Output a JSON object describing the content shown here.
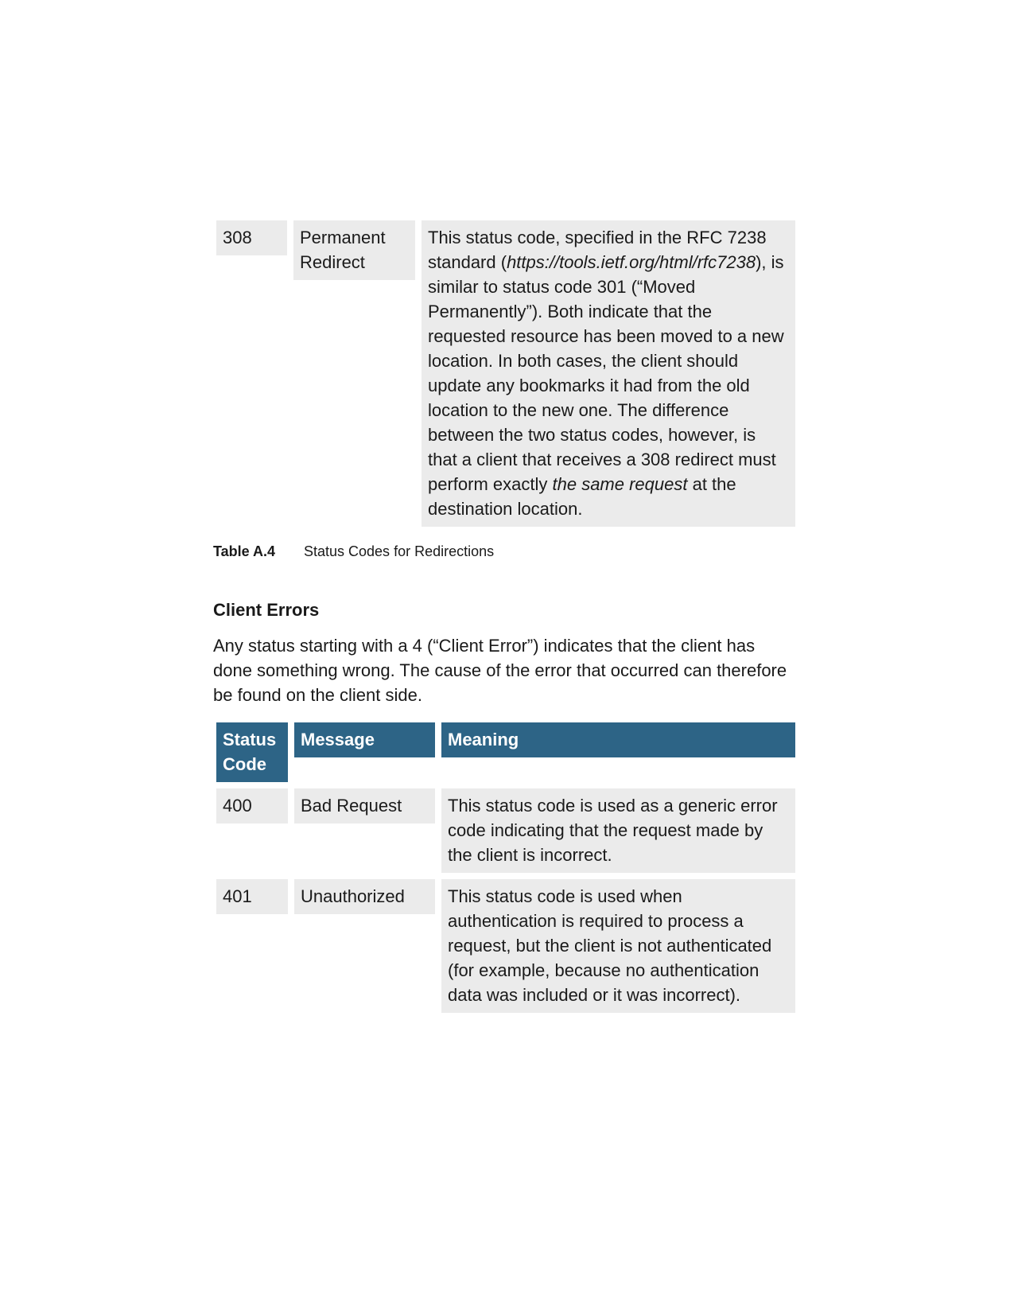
{
  "table_a4": {
    "row_308": {
      "code": "308",
      "message_line1": "Permanent",
      "message_line2": "Redirect",
      "meaning_part1": "This status code, specified in the RFC 7238 standard (",
      "meaning_link": "https://tools.ietf.org/html/rfc7238",
      "meaning_part2": "), is similar to status code 301 (“Moved Permanently”). Both indicate that the requested resource has been moved to a new location. In both cases, the client should update any bookmarks it had from the old location to the new one. The difference between the two status codes, however, is that a client that receives a 308 redirect must perform exactly ",
      "meaning_emphasis": "the same request",
      "meaning_part3": " at the destination location."
    },
    "caption_number": "Table A.4",
    "caption_text": "Status Codes for Redirections"
  },
  "client_errors": {
    "heading": "Client Errors",
    "intro": "Any status starting with a 4 (“Client Error”) indicates that the client has done something wrong. The cause of the error that occurred can therefore be found on the client side."
  },
  "table_a5": {
    "headers": {
      "code_line1": "Status",
      "code_line2": "Code",
      "message": "Message",
      "meaning": "Meaning"
    },
    "rows": [
      {
        "code": "400",
        "message": "Bad Request",
        "meaning": "This status code is used as a generic error code indicating that the request made by the client is incorrect."
      },
      {
        "code": "401",
        "message": "Unauthorized",
        "meaning": "This status code is used when authentication is required to process a request, but the client is not authenticated (for example, because no authentication data was included or it was incorrect)."
      }
    ]
  },
  "colors": {
    "header_bg": "#2d6486",
    "cell_bg": "#ebebeb"
  }
}
